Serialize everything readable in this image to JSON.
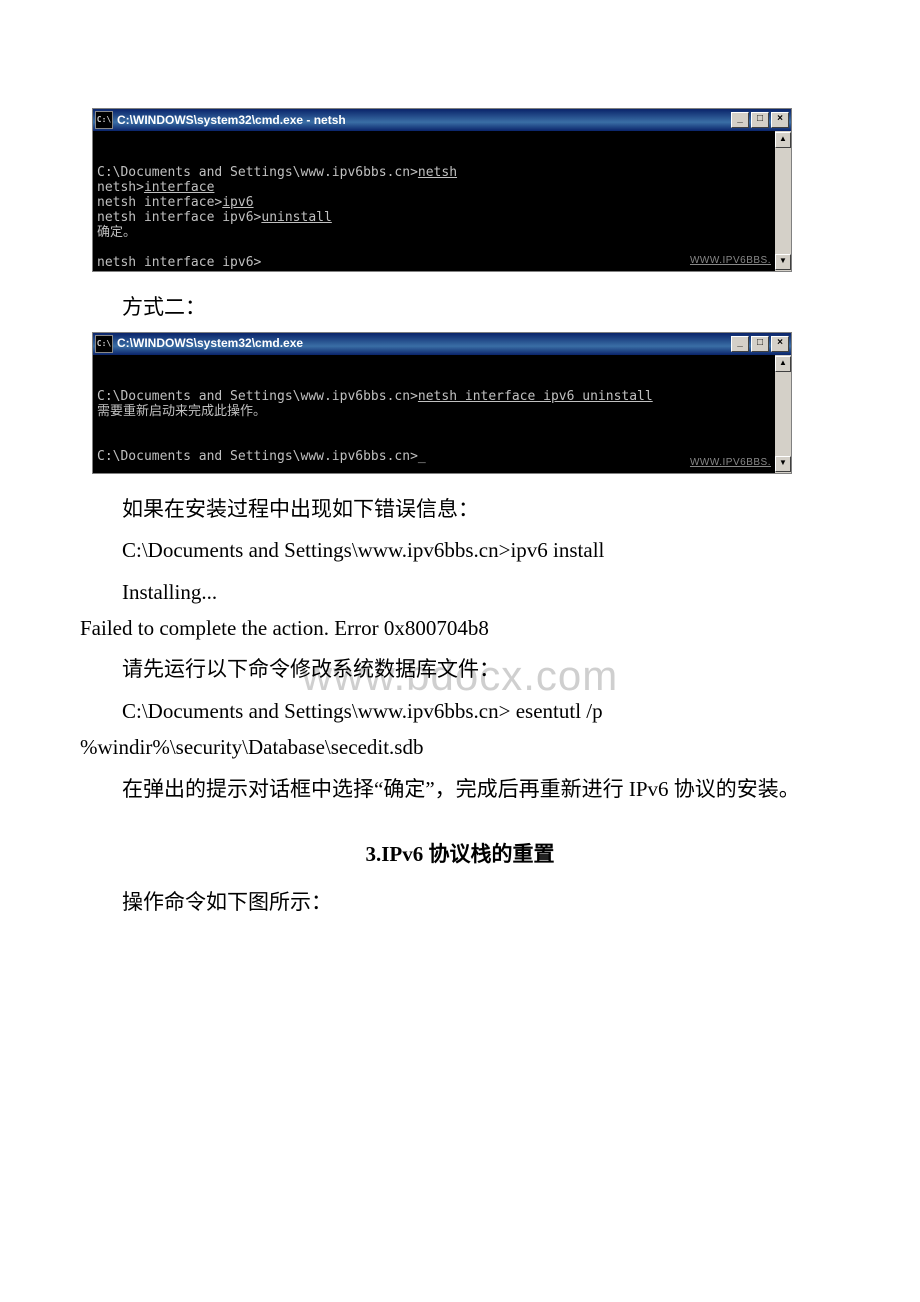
{
  "terminal1": {
    "title": "C:\\WINDOWS\\system32\\cmd.exe - netsh",
    "icon_label": "C:\\",
    "line1_prompt": "C:\\Documents and Settings\\www.ipv6bbs.cn>",
    "line1_cmd": "netsh",
    "line2_prompt": "netsh>",
    "line2_cmd": "interface",
    "line3_prompt": "netsh interface>",
    "line3_cmd": "ipv6",
    "line4_prompt": "netsh interface ipv6>",
    "line4_cmd": "uninstall",
    "line5": "确定。",
    "line6": "netsh interface ipv6>",
    "watermark": "WWW.IPV6BBS."
  },
  "method2_label": "方式二：",
  "terminal2": {
    "title": "C:\\WINDOWS\\system32\\cmd.exe",
    "icon_label": "C:\\",
    "line1_prompt": "C:\\Documents and Settings\\www.ipv6bbs.cn>",
    "line1_cmd": "netsh interface ipv6 uninstall",
    "line2": "需要重新启动来完成此操作。",
    "line3": "C:\\Documents and Settings\\www.ipv6bbs.cn>_",
    "watermark": "WWW.IPV6BBS."
  },
  "p_error_intro": "如果在安装过程中出现如下错误信息：",
  "p_err_line1": "C:\\Documents and Settings\\www.ipv6bbs.cn>ipv6 install",
  "p_err_line2": "Installing...",
  "p_err_line3": "Failed to complete the action. Error 0x800704b8",
  "p_fix_intro": "请先运行以下命令修改系统数据库文件：",
  "p_fix_cmd_l1": "C:\\Documents and Settings\\www.ipv6bbs.cn> esentutl /p ",
  "p_fix_cmd_l2": "%windir%\\security\\Database\\secedit.sdb",
  "p_confirm": "在弹出的提示对话框中选择“确定”，完成后再重新进行 IPv6 协议的安装。",
  "heading3": "3.IPv6 协议栈的重置",
  "p_ops": "操作命令如下图所示：",
  "page_watermark": "www.bdocx.com",
  "controls": {
    "min": "_",
    "max": "□",
    "close": "×",
    "up": "▲",
    "down": "▼"
  }
}
